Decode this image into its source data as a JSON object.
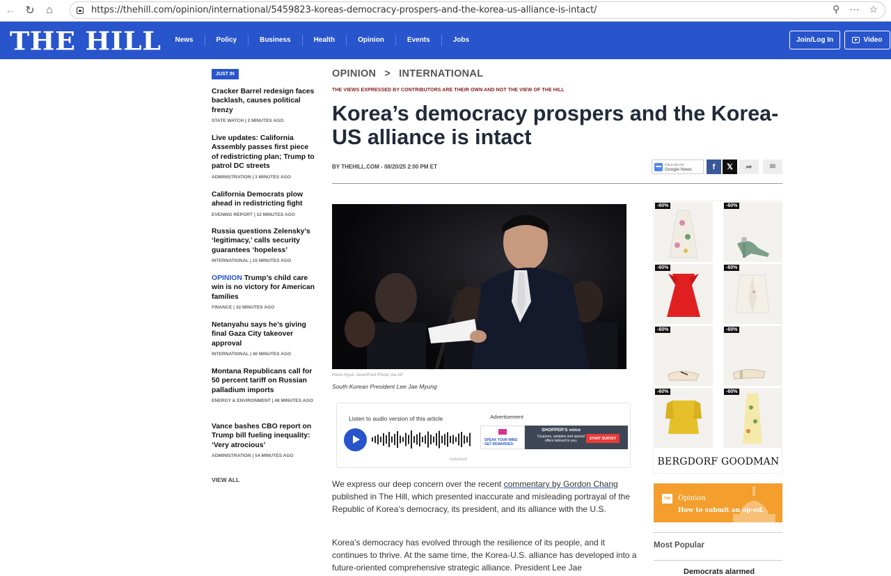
{
  "browser": {
    "url": "https://thehill.com/opinion/international/5459823-koreas-democracy-prospers-and-the-korea-us-alliance-is-intact/"
  },
  "header": {
    "logo": "THE HILL",
    "nav": [
      "News",
      "Policy",
      "Business",
      "Health",
      "Opinion",
      "Events",
      "Jobs"
    ],
    "join_label": "Join/Log In",
    "video_label": "Video"
  },
  "just_in": {
    "tag": "JUST IN",
    "stories": [
      {
        "title": "Cracker Barrel redesign faces backlash, causes political frenzy",
        "meta": "STATE WATCH | 2 MINUTES AGO"
      },
      {
        "title": "Live updates: California Assembly passes first piece of redistricting plan; Trump to patrol DC streets",
        "meta": "ADMINISTRATION | 3 MINUTES AGO"
      },
      {
        "title": "California Democrats plow ahead in redistricting fight",
        "meta": "EVENING REPORT | 12 MINUTES AGO"
      },
      {
        "title": "Russia questions Zelensky’s ‘legitimacy,’ calls security guarantees ‘hopeless’",
        "meta": "INTERNATIONAL | 15 MINUTES AGO"
      },
      {
        "prefix": "OPINION",
        "title": "Trump’s child care win is no victory for American families",
        "meta": "FINANCE | 32 MINUTES AGO"
      },
      {
        "title": "Netanyahu says he’s giving final Gaza City takeover approval",
        "meta": "INTERNATIONAL | 40 MINUTES AGO"
      },
      {
        "title": "Montana Republicans call for 50 percent tariff on Russian palladium imports",
        "meta": "ENERGY & ENVIRONMENT | 48 MINUTES AGO"
      },
      {
        "title": "Vance bashes CBO report on Trump bill fueling inequality: ‘Very atrocious’",
        "meta": "ADMINISTRATION | 54 MINUTES AGO"
      }
    ],
    "view_all": "VIEW ALL"
  },
  "article": {
    "section": "OPINION",
    "subsection": "INTERNATIONAL",
    "separator": ">",
    "disclaimer": "THE VIEWS EXPRESSED BY CONTRIBUTORS ARE THEIR OWN AND NOT THE VIEW OF THE HILL",
    "headline": "Korea’s democracy prospers and the Korea-US alliance is intact",
    "byline": "BY THEHILL.COM - 08/20/25 2:00 PM ET",
    "photo_credit": "Heon-Kyun Jeon/Pool Photo via AP",
    "photo_caption": "South Korean President Lee Jae Myung",
    "p1_before": "We express our deep concern over the recent ",
    "p1_link": "commentary by Gordon Chang",
    "p1_after": " published in The Hill, which presented inaccurate and misleading portrayal of the Republic of Korea’s democracy, its president, and its alliance with the U.S.",
    "p2": "Korea’s democracy has evolved through the resilience of its people, and it continues to thrive. At the same time, the Korea-U.S. alliance has developed into a future-oriented comprehensive strategic alliance. President Lee Jae"
  },
  "share": {
    "gnews_top": "FOLLOW ON",
    "gnews_label": "Google News",
    "facebook": "f",
    "x": "𝕏",
    "forward": "➦",
    "email": "✉"
  },
  "audio": {
    "label": "Listen to audio version of this article",
    "ad_label": "Advertisement",
    "ad_left": "SPEAK YOUR MIND. GET REWARDED.",
    "ad_brand": "SHOPPER'S voice",
    "ad_mid": "Coupons, samples and special offers tailored to you.",
    "ad_button": "START SURVEY",
    "powered": "instaread"
  },
  "rail": {
    "discount": "-60%",
    "brand": "BERGDORF GOODMAN",
    "opinion_logo": "THE HILL",
    "opinion_title": "Opinion",
    "opinion_cta": "How to submit an op-ed.",
    "most_popular": "Most Popular",
    "popular_peek": "Democrats alarmed"
  },
  "colors": {
    "brand_blue": "#2854cc",
    "disclaimer_red": "#8b1a1a",
    "opinion_orange": "#f39e2d"
  }
}
